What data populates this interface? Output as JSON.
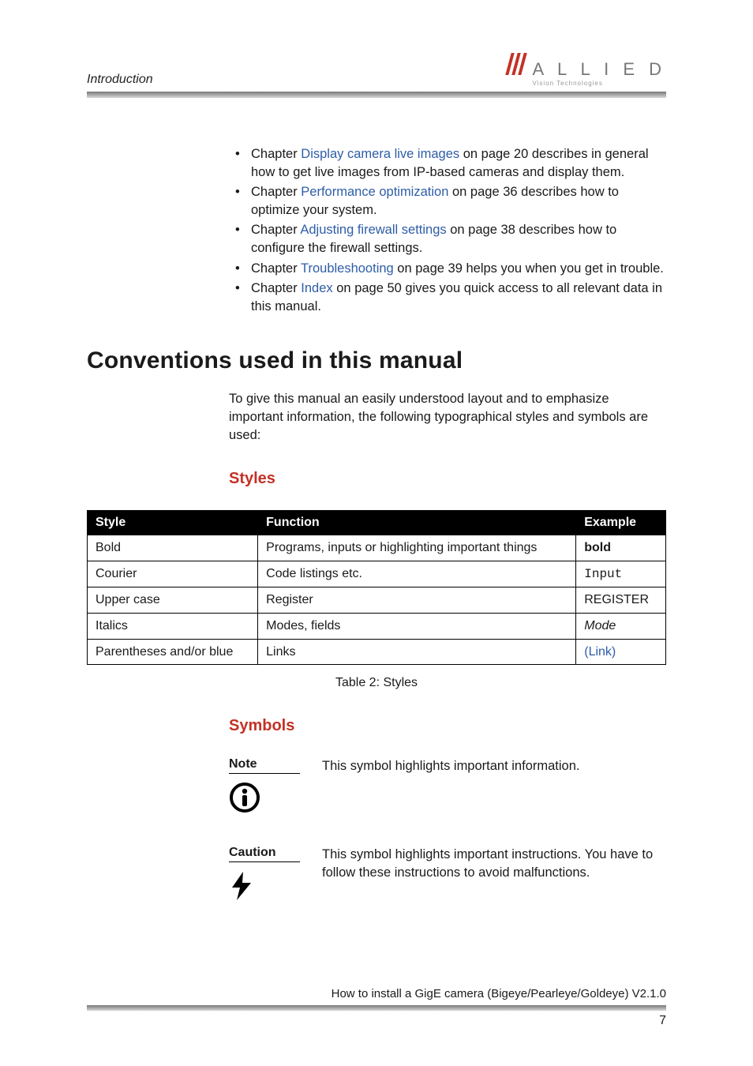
{
  "header": {
    "running_title": "Introduction",
    "logo_top": "A L L I E D",
    "logo_sub": "Vision Technologies"
  },
  "bullets": [
    {
      "pre": "Chapter ",
      "link": "Display camera live images",
      "post": " on page 20 describes in general how to get live images from IP-based cameras and display them."
    },
    {
      "pre": "Chapter ",
      "link": "Performance optimization",
      "post": " on page 36 describes how to optimize your system."
    },
    {
      "pre": "Chapter ",
      "link": "Adjusting firewall settings",
      "post": " on page 38 describes how to configure the firewall settings."
    },
    {
      "pre": "Chapter ",
      "link": "Troubleshooting",
      "post": " on page 39 helps you when you get in trouble."
    },
    {
      "pre": "Chapter ",
      "link": "Index",
      "post": " on page 50 gives you quick access to all relevant data in this manual."
    }
  ],
  "section_title": "Conventions used in this manual",
  "intro": "To give this manual an easily understood layout and to emphasize important information, the following typographical styles and symbols are used:",
  "styles_heading": "Styles",
  "table": {
    "headers": [
      "Style",
      "Function",
      "Example"
    ],
    "rows": [
      {
        "style": "Bold",
        "function": "Programs, inputs or highlighting important things",
        "example": "bold",
        "ex_class": "ex-bold"
      },
      {
        "style": "Courier",
        "function": "Code listings etc.",
        "example": "Input",
        "ex_class": "ex-mono"
      },
      {
        "style": "Upper case",
        "function": "Register",
        "example": "REGISTER",
        "ex_class": ""
      },
      {
        "style": "Italics",
        "function": "Modes, fields",
        "example": "Mode",
        "ex_class": "ex-italic"
      },
      {
        "style": "Parentheses and/or blue",
        "function": "Links",
        "example": "(Link)",
        "ex_class": "ex-link"
      }
    ],
    "caption": "Table 2: Styles"
  },
  "symbols_heading": "Symbols",
  "symbols": [
    {
      "label": "Note",
      "text": "This symbol highlights important information.",
      "icon": "info"
    },
    {
      "label": "Caution",
      "text": "This symbol highlights important instructions. You have to follow these instructions to avoid malfunctions.",
      "icon": "bolt"
    }
  ],
  "footer": {
    "text": "How to install a GigE camera (Bigeye/Pearleye/Goldeye) V2.1.0",
    "page": "7"
  }
}
